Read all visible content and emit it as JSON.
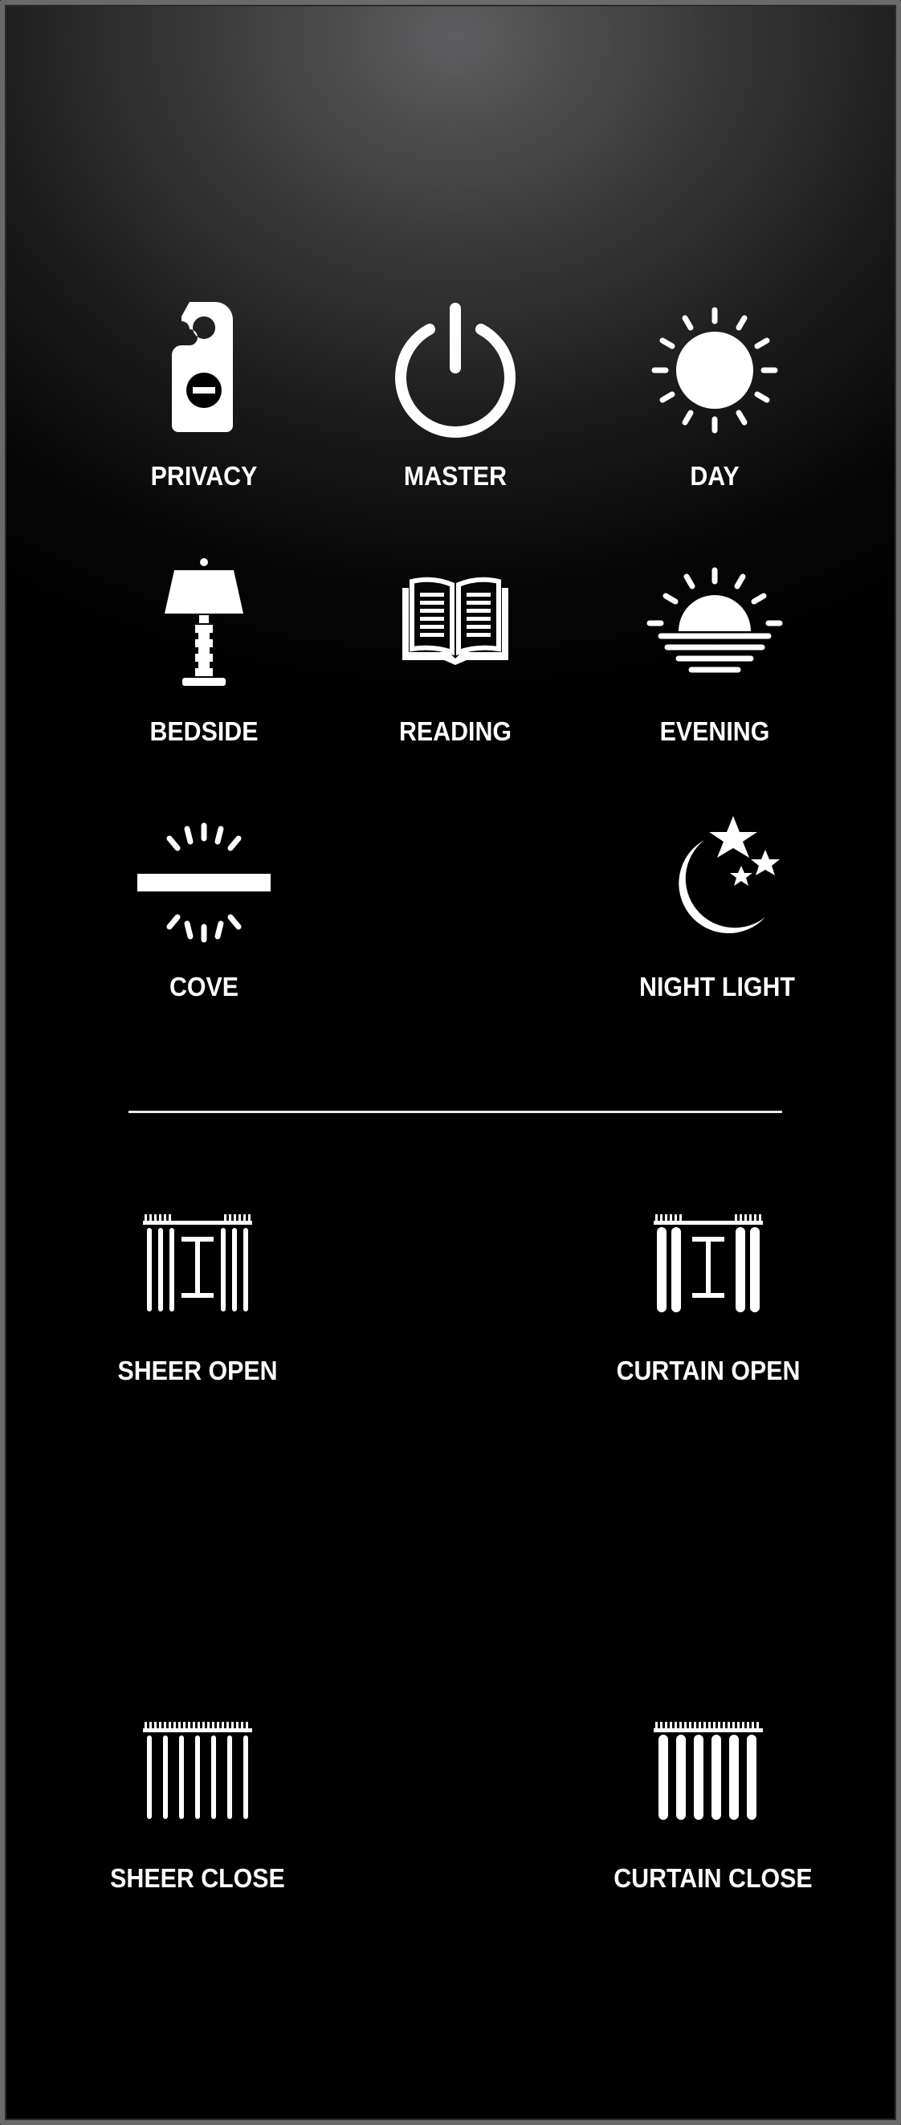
{
  "panel": {
    "scenes": [
      {
        "label": "PRIVACY",
        "icon": "door-hanger-icon"
      },
      {
        "label": "MASTER",
        "icon": "power-icon"
      },
      {
        "label": "DAY",
        "icon": "sun-icon"
      },
      {
        "label": "BEDSIDE",
        "icon": "lamp-icon"
      },
      {
        "label": "READING",
        "icon": "book-icon"
      },
      {
        "label": "EVENING",
        "icon": "sunset-icon"
      },
      {
        "label": "COVE",
        "icon": "cove-light-icon"
      },
      {
        "label": "NIGHT LIGHT",
        "icon": "moon-stars-icon"
      }
    ],
    "curtains": [
      {
        "label": "SHEER OPEN",
        "icon": "sheer-open-icon"
      },
      {
        "label": "CURTAIN OPEN",
        "icon": "curtain-open-icon"
      },
      {
        "label": "SHEER CLOSE",
        "icon": "sheer-close-icon"
      },
      {
        "label": "CURTAIN CLOSE",
        "icon": "curtain-close-icon"
      }
    ]
  },
  "colors": {
    "foreground": "#ffffff",
    "background": "#000000",
    "divider": "#e9e9e9"
  }
}
